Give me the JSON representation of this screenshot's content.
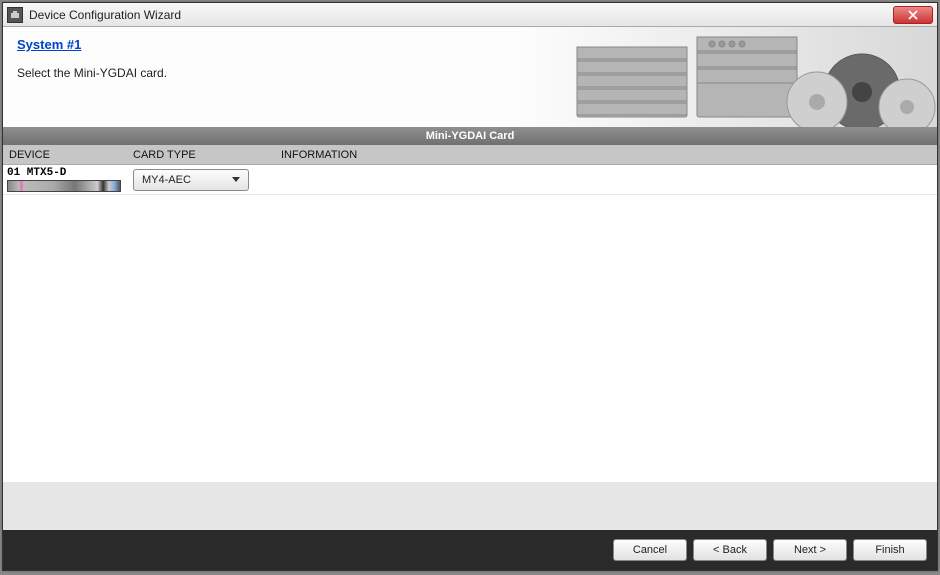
{
  "window": {
    "title": "Device Configuration Wizard"
  },
  "banner": {
    "system_title": "System #1",
    "instruction": "Select the Mini-YGDAI card."
  },
  "section": {
    "header": "Mini-YGDAI Card"
  },
  "columns": {
    "device": "DEVICE",
    "card_type": "CARD TYPE",
    "information": "INFORMATION"
  },
  "rows": [
    {
      "device_label": "01 MTX5-D",
      "card_selected": "MY4-AEC",
      "information": ""
    }
  ],
  "footer": {
    "cancel": "Cancel",
    "back": "< Back",
    "next": "Next >",
    "finish": "Finish"
  }
}
